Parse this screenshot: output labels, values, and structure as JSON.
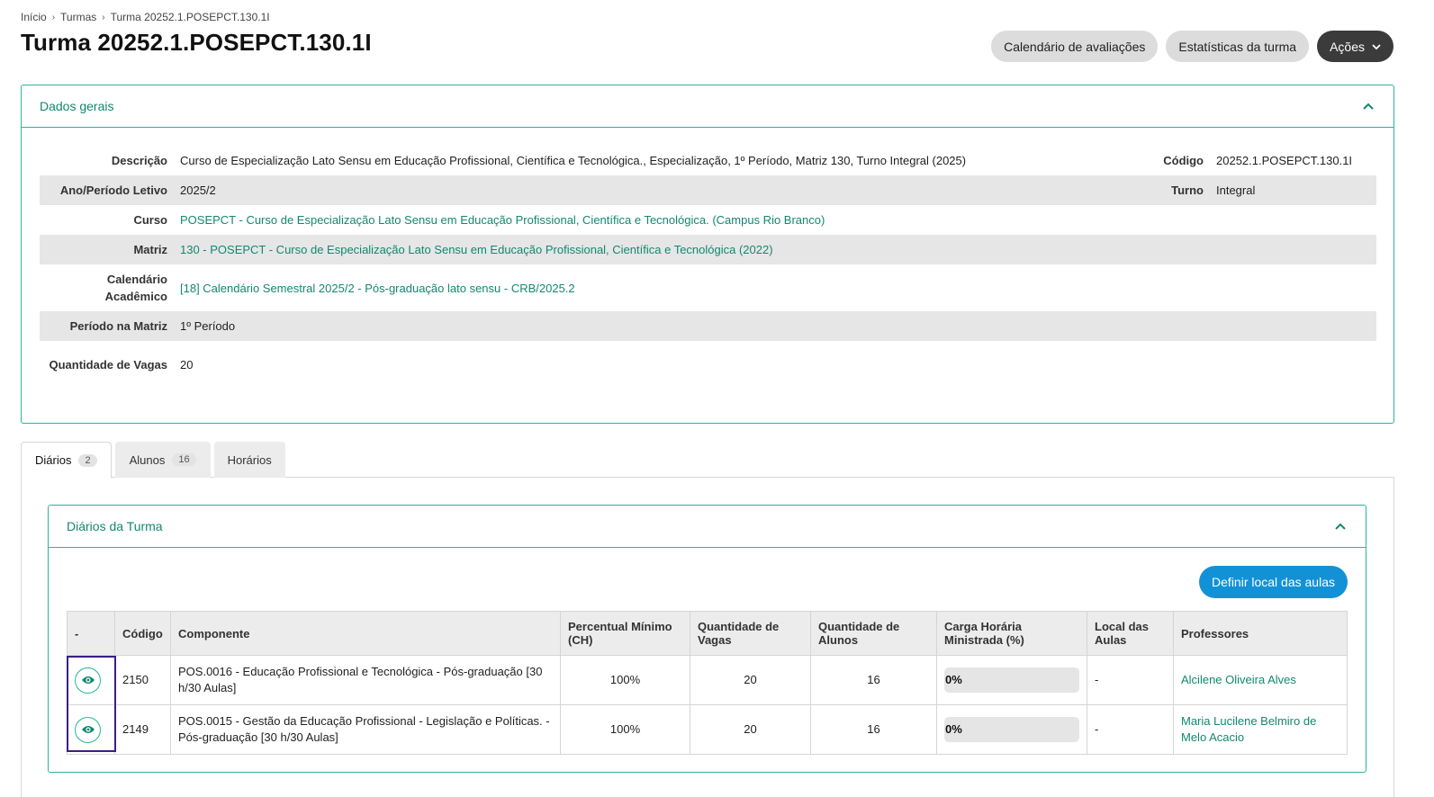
{
  "breadcrumb": [
    "Início",
    "Turmas",
    "Turma 20252.1.POSEPCT.130.1I"
  ],
  "page_title": "Turma 20252.1.POSEPCT.130.1I",
  "actions": {
    "calendario": "Calendário de avaliações",
    "estatisticas": "Estatísticas da turma",
    "acoes": "Ações"
  },
  "dados_gerais": {
    "title": "Dados gerais",
    "rows": [
      {
        "label": "Descrição",
        "value": "Curso de Especialização Lato Sensu em Educação Profissional, Científica e Tecnológica., Especialização, 1º Período, Matriz 130, Turno Integral (2025)",
        "label2": "Código",
        "value2": "20252.1.POSEPCT.130.1I"
      },
      {
        "label": "Ano/Período Letivo",
        "value": "2025/2",
        "label2": "Turno",
        "value2": "Integral"
      },
      {
        "label": "Curso",
        "value": "POSEPCT - Curso de Especialização Lato Sensu em Educação Profissional, Científica e Tecnológica. (Campus Rio Branco)"
      },
      {
        "label": "Matriz",
        "value": "130 - POSEPCT - Curso de Especialização Lato Sensu em Educação Profissional, Científica e Tecnológica (2022)"
      },
      {
        "label": "Calendário Acadêmico",
        "value": "[18] Calendário Semestral 2025/2 - Pós-graduação lato sensu - CRB/2025.2"
      },
      {
        "label": "Período na Matriz",
        "value": "1º Período"
      },
      {
        "label": "Quantidade de Vagas",
        "value": "20"
      }
    ]
  },
  "tabs": [
    {
      "label": "Diários",
      "count": "2"
    },
    {
      "label": "Alunos",
      "count": "16"
    },
    {
      "label": "Horários"
    }
  ],
  "diarios": {
    "title": "Diários da Turma",
    "button": "Definir local das aulas",
    "headers": [
      "-",
      "Código",
      "Componente",
      "Percentual Mínimo (CH)",
      "Quantidade de Vagas",
      "Quantidade de Alunos",
      "Carga Horária Ministrada (%)",
      "Local das Aulas",
      "Professores"
    ],
    "rows": [
      {
        "codigo": "2150",
        "componente": "POS.0016 - Educação Profissional e Tecnológica - Pós-graduação [30 h/30 Aulas]",
        "percentual": "100%",
        "vagas": "20",
        "alunos": "16",
        "carga_label": "0%",
        "carga": 0,
        "local": "-",
        "professor": "Alcilene Oliveira Alves"
      },
      {
        "codigo": "2149",
        "componente": "POS.0015 - Gestão da Educação Profissional - Legislação e Políticas. - Pós-graduação [30 h/30 Aulas]",
        "percentual": "100%",
        "vagas": "20",
        "alunos": "16",
        "carga_label": "0%",
        "carga": 0,
        "local": "-",
        "professor": "Maria Lucilene Belmiro de Melo Acacio"
      }
    ]
  },
  "colors": {
    "accent": "#2cb49a",
    "link": "#128870",
    "primary": "#1391d6",
    "highlight": "#3a1e86"
  }
}
